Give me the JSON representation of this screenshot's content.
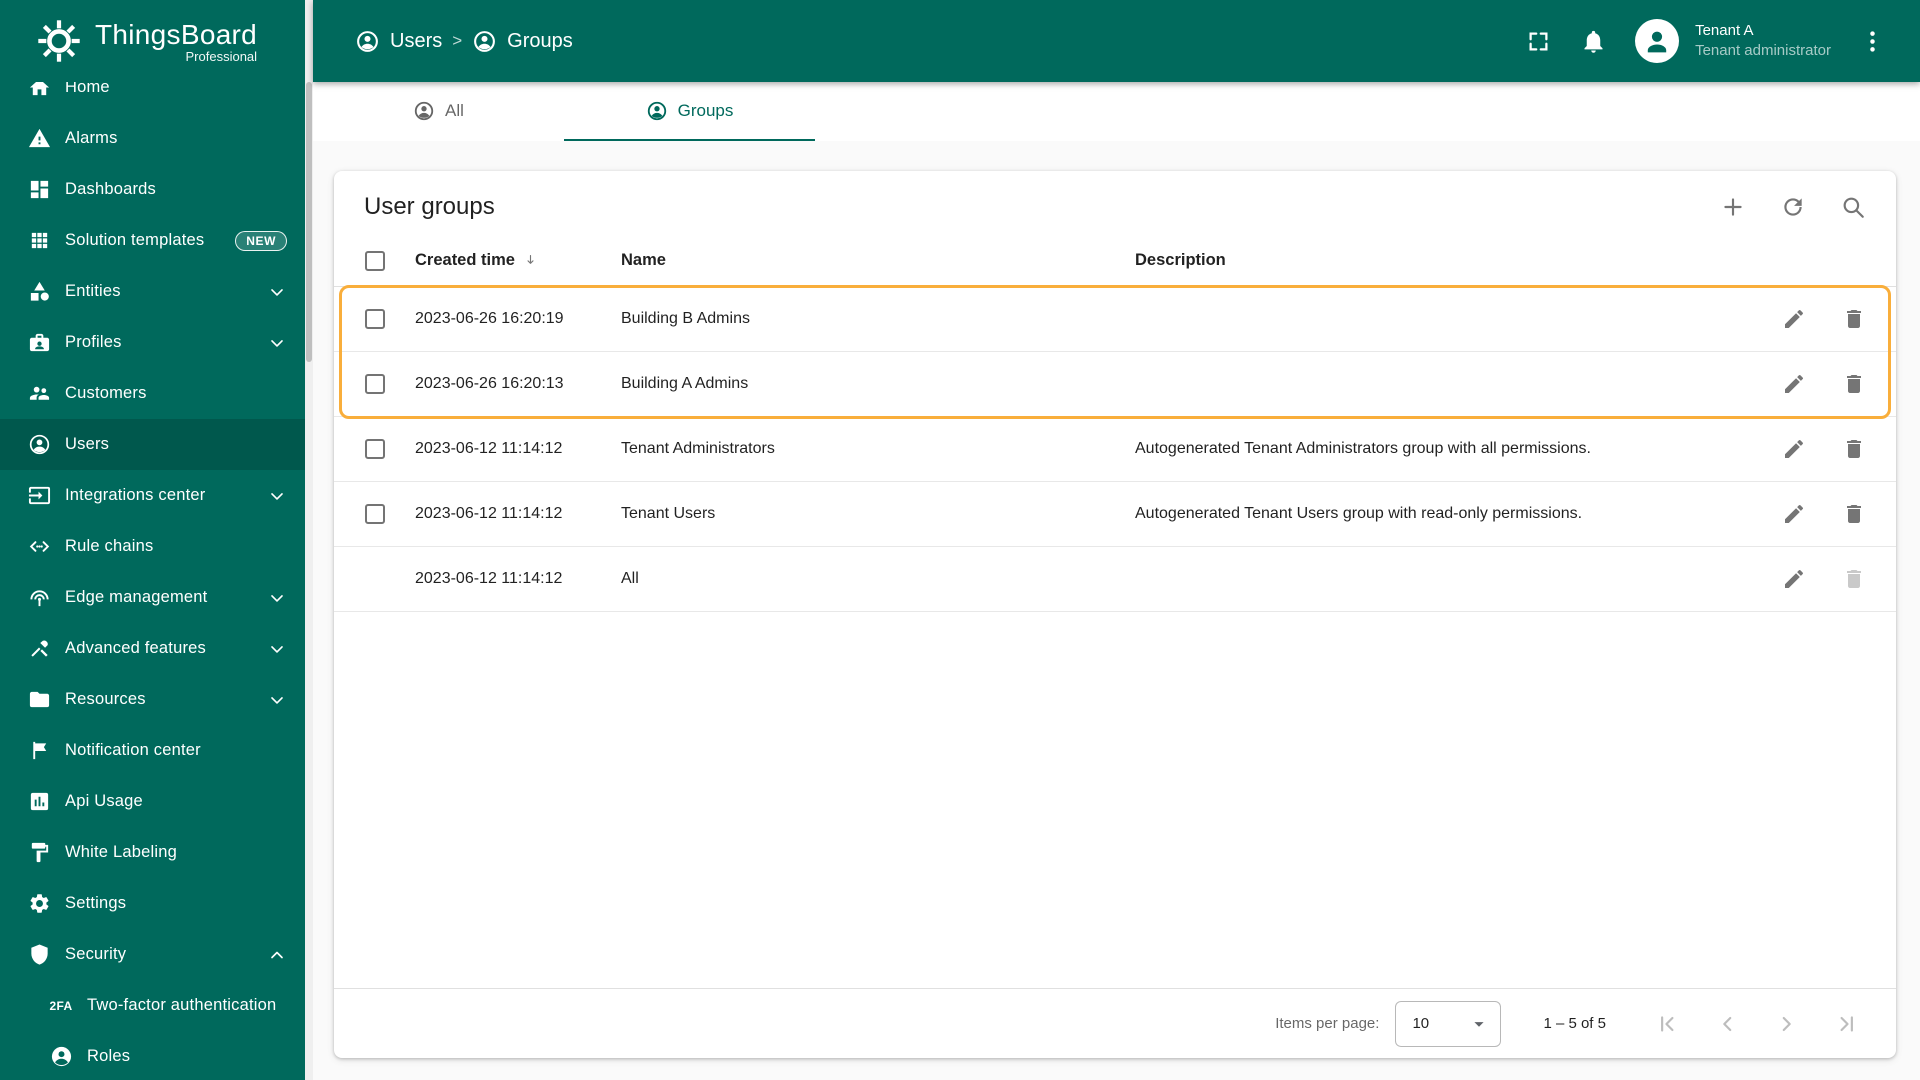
{
  "colors": {
    "primary": "#00695C",
    "highlight": "#F9AE3B"
  },
  "brand": {
    "name": "ThingsBoard",
    "edition": "Professional"
  },
  "breadcrumb": {
    "separator": ">",
    "items": [
      {
        "label": "Users"
      },
      {
        "label": "Groups"
      }
    ]
  },
  "topbar": {
    "tenant_name": "Tenant A",
    "tenant_role": "Tenant administrator"
  },
  "sidebar": {
    "items": [
      {
        "label": "Home",
        "icon": "home-icon"
      },
      {
        "label": "Alarms",
        "icon": "alarms-icon"
      },
      {
        "label": "Dashboards",
        "icon": "dashboards-icon"
      },
      {
        "label": "Solution templates",
        "icon": "solution-templates-icon",
        "badge": "NEW"
      },
      {
        "label": "Entities",
        "icon": "entities-icon",
        "expandable": true
      },
      {
        "label": "Profiles",
        "icon": "profiles-icon",
        "expandable": true
      },
      {
        "label": "Customers",
        "icon": "customers-icon"
      },
      {
        "label": "Users",
        "icon": "users-icon",
        "active": true
      },
      {
        "label": "Integrations center",
        "icon": "integrations-center-icon",
        "expandable": true
      },
      {
        "label": "Rule chains",
        "icon": "rule-chains-icon"
      },
      {
        "label": "Edge management",
        "icon": "edge-management-icon",
        "expandable": true
      },
      {
        "label": "Advanced features",
        "icon": "advanced-features-icon",
        "expandable": true
      },
      {
        "label": "Resources",
        "icon": "resources-icon",
        "expandable": true
      },
      {
        "label": "Notification center",
        "icon": "notification-center-icon"
      },
      {
        "label": "Api Usage",
        "icon": "api-usage-icon"
      },
      {
        "label": "White Labeling",
        "icon": "white-labeling-icon"
      },
      {
        "label": "Settings",
        "icon": "settings-icon"
      },
      {
        "label": "Security",
        "icon": "security-icon",
        "expandable": true,
        "expanded": true
      },
      {
        "label": "Two-factor authentication",
        "icon": "two-factor-icon",
        "glyph": "2FA",
        "child": true
      },
      {
        "label": "Roles",
        "icon": "roles-icon",
        "child": true
      }
    ]
  },
  "tabs": [
    {
      "label": "All",
      "active": false
    },
    {
      "label": "Groups",
      "active": true
    }
  ],
  "card": {
    "title": "User groups"
  },
  "table": {
    "columns": {
      "created": "Created time",
      "name": "Name",
      "description": "Description"
    },
    "rows": [
      {
        "created": "2023-06-26 16:20:19",
        "name": "Building B Admins",
        "description": "",
        "checkbox": true,
        "highlighted": true
      },
      {
        "created": "2023-06-26 16:20:13",
        "name": "Building A Admins",
        "description": "",
        "checkbox": true,
        "highlighted": true
      },
      {
        "created": "2023-06-12 11:14:12",
        "name": "Tenant Administrators",
        "description": "Autogenerated Tenant Administrators group with all permissions.",
        "checkbox": true
      },
      {
        "created": "2023-06-12 11:14:12",
        "name": "Tenant Users",
        "description": "Autogenerated Tenant Users group with read-only permissions.",
        "checkbox": true
      },
      {
        "created": "2023-06-12 11:14:12",
        "name": "All",
        "description": "",
        "checkbox": false,
        "delete_disabled": true
      }
    ]
  },
  "pagination": {
    "items_per_page_label": "Items per page:",
    "page_size": "10",
    "range": "1 – 5 of 5"
  }
}
